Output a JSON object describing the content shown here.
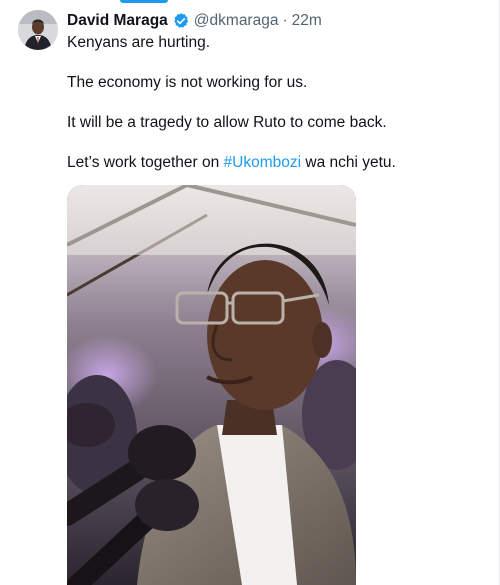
{
  "tweet": {
    "author_name": "David Maraga",
    "handle": "@dkmaraga",
    "separator": "·",
    "time": "22m",
    "lines": [
      "Kenyans are hurting.",
      "The economy is not working for us.",
      "It will be a tragedy to allow Ruto to come back."
    ],
    "last_line": {
      "prefix": "Let’s work together on ",
      "hashtag": "#Ukombozi",
      "suffix": " wa nchi yetu."
    }
  },
  "colors": {
    "accent": "#1d9bf0",
    "text": "#0f1419",
    "secondary": "#536471"
  },
  "icons": {
    "verified": "verified-badge-icon"
  }
}
